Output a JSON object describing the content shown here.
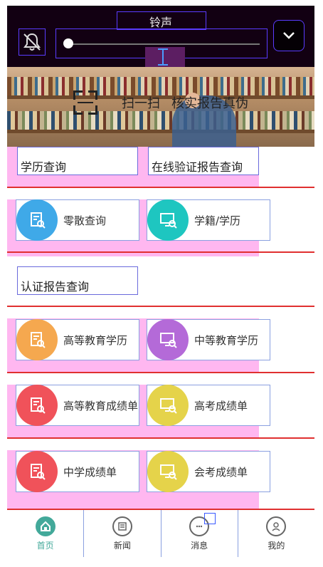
{
  "volume": {
    "title": "铃声",
    "level": 0.0
  },
  "banner": {
    "scan_label": "扫一扫",
    "verify_label": "核实报告真伪"
  },
  "sections": [
    {
      "title": "学历查询",
      "title2": "在线验证报告查询"
    },
    {
      "title": "认证报告查询"
    }
  ],
  "items": [
    {
      "label": "零散查询",
      "icon": "document-search-icon",
      "color": "#3fa9e8"
    },
    {
      "label": "学籍/学历",
      "icon": "monitor-search-icon",
      "color": "#1ec6c0"
    },
    {
      "label": "高等教育学历",
      "icon": "document-search-icon",
      "color": "#f5a84f"
    },
    {
      "label": "中等教育学历",
      "icon": "monitor-search-icon",
      "color": "#b46ad8"
    },
    {
      "label": "高等教育成绩单",
      "icon": "document-search-icon",
      "color": "#f0525a"
    },
    {
      "label": "高考成绩单",
      "icon": "monitor-search-icon",
      "color": "#e5d34a"
    },
    {
      "label": "中学成绩单",
      "icon": "document-search-icon",
      "color": "#f0525a"
    },
    {
      "label": "会考成绩单",
      "icon": "monitor-search-icon",
      "color": "#e5d34a"
    }
  ],
  "tabs": [
    {
      "label": "首页",
      "icon": "home-icon",
      "active": true
    },
    {
      "label": "新闻",
      "icon": "news-icon",
      "active": false
    },
    {
      "label": "消息",
      "icon": "message-icon",
      "active": false
    },
    {
      "label": "我的",
      "icon": "profile-icon",
      "active": false
    }
  ],
  "colors": {
    "accent": "#43a99a",
    "highlight": "#ffb7f0",
    "divider": "#e03030"
  }
}
